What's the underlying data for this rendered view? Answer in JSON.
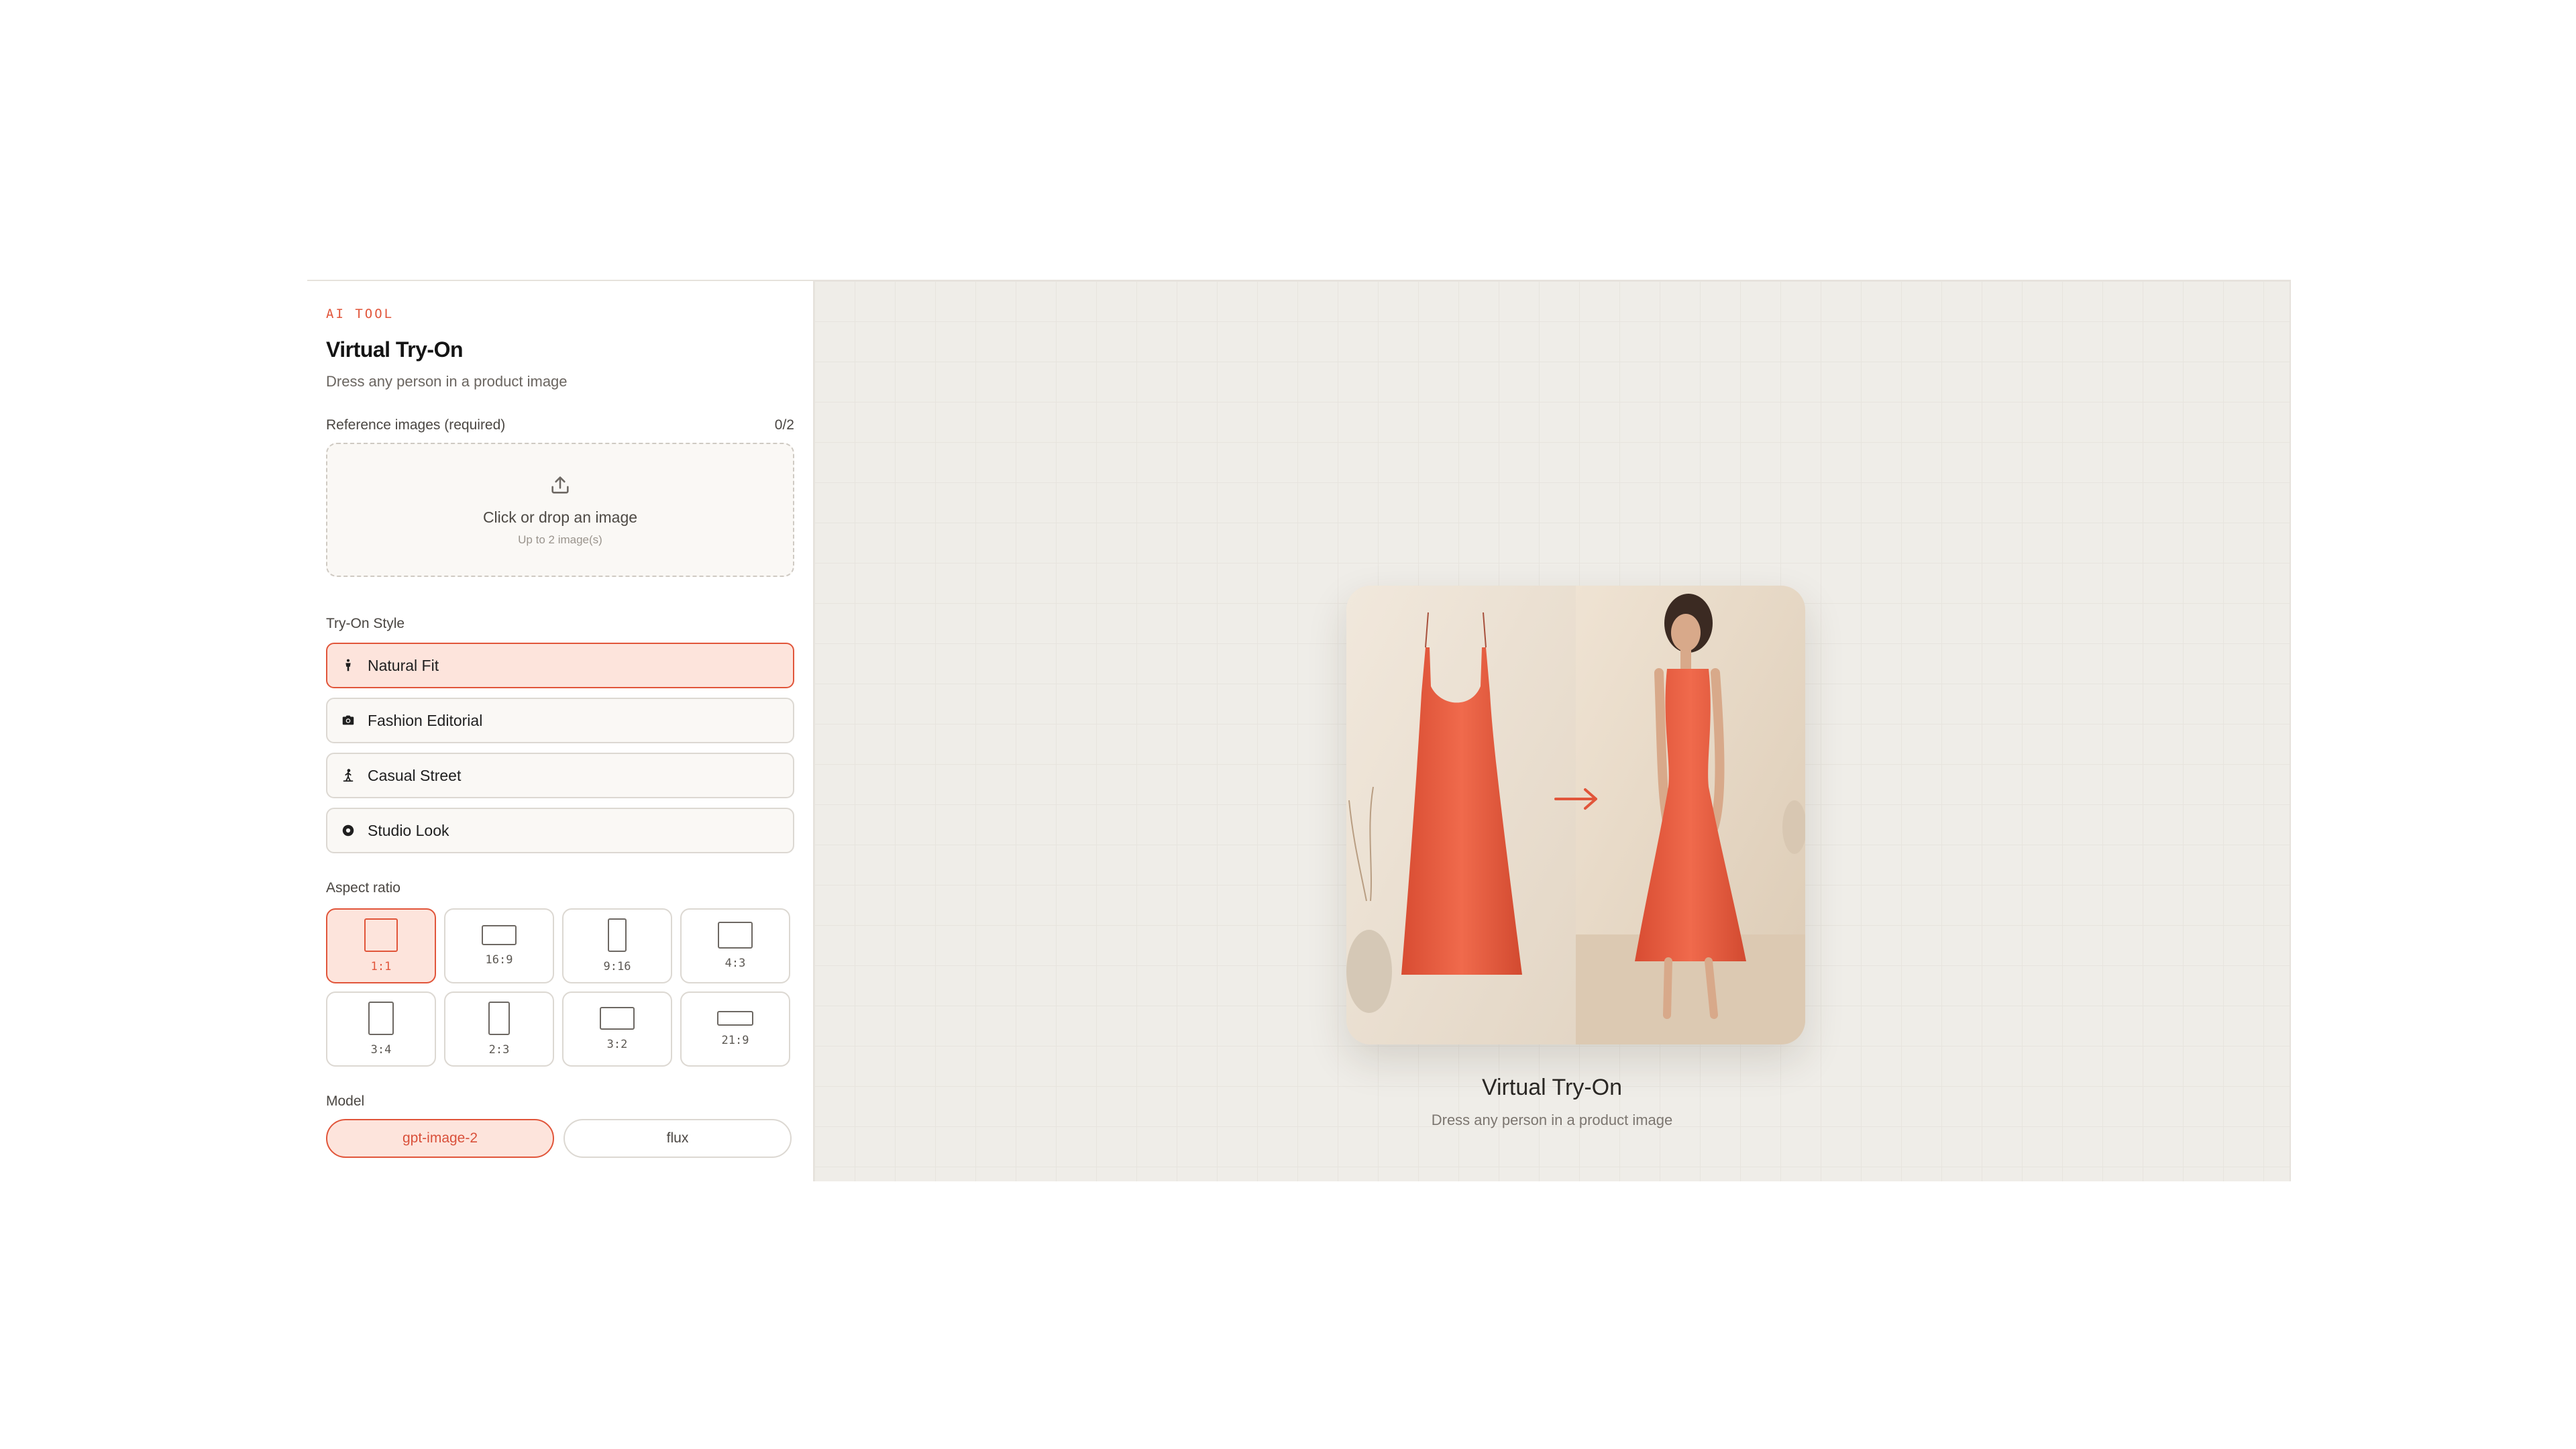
{
  "sidebar": {
    "eyebrow": "AI TOOL",
    "title": "Virtual Try-On",
    "subtitle": "Dress any person in a product image",
    "reference": {
      "label": "Reference images (required)",
      "count": "0/2",
      "drop_main": "Click or drop an image",
      "drop_sub": "Up to 2 image(s)",
      "icon": "upload-icon"
    },
    "style": {
      "label": "Try-On Style",
      "options": [
        {
          "label": "Natural Fit",
          "icon": "person-icon",
          "active": true
        },
        {
          "label": "Fashion Editorial",
          "icon": "camera-icon",
          "active": false
        },
        {
          "label": "Casual Street",
          "icon": "walking-icon",
          "active": false
        },
        {
          "label": "Studio Look",
          "icon": "aperture-icon",
          "active": false
        }
      ]
    },
    "aspect": {
      "label": "Aspect ratio",
      "options": [
        "1:1",
        "16:9",
        "9:16",
        "4:3",
        "3:4",
        "2:3",
        "3:2",
        "21:9"
      ],
      "selected": "1:1"
    },
    "model": {
      "label": "Model",
      "options": [
        "gpt-image-2",
        "flux"
      ],
      "selected": "gpt-image-2"
    }
  },
  "preview": {
    "title": "Virtual Try-On",
    "subtitle": "Dress any person in a product image",
    "arrow_icon": "arrow-right-icon"
  },
  "colors": {
    "accent": "#e1553a",
    "accent_bg": "#fde4dc",
    "canvas_bg": "#efede8",
    "dress": "#ea5f44"
  }
}
